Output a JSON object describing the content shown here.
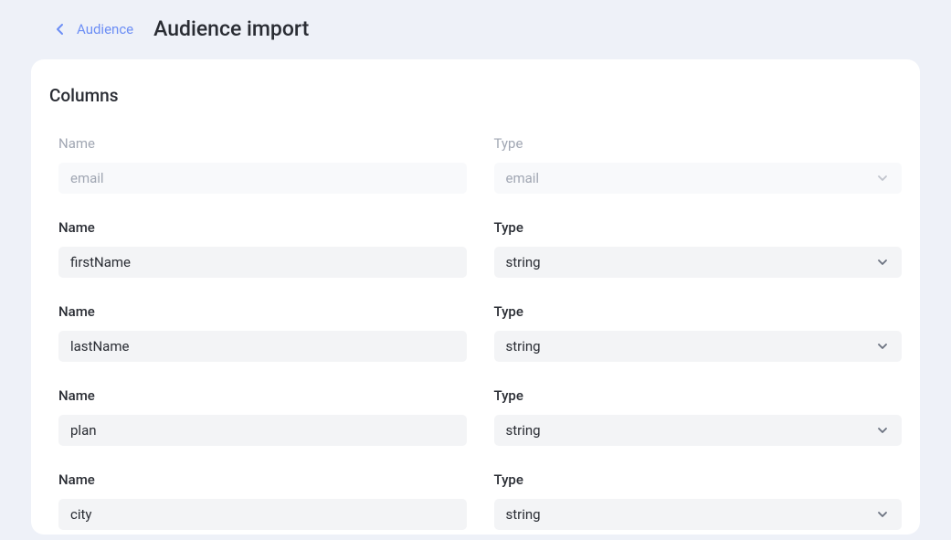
{
  "header": {
    "breadcrumb_link": "Audience",
    "page_title": "Audience import"
  },
  "section": {
    "title": "Columns",
    "name_label": "Name",
    "type_label": "Type"
  },
  "rows": [
    {
      "name": "email",
      "type": "email",
      "disabled": true
    },
    {
      "name": "firstName",
      "type": "string",
      "disabled": false
    },
    {
      "name": "lastName",
      "type": "string",
      "disabled": false
    },
    {
      "name": "plan",
      "type": "string",
      "disabled": false
    },
    {
      "name": "city",
      "type": "string",
      "disabled": false
    }
  ]
}
